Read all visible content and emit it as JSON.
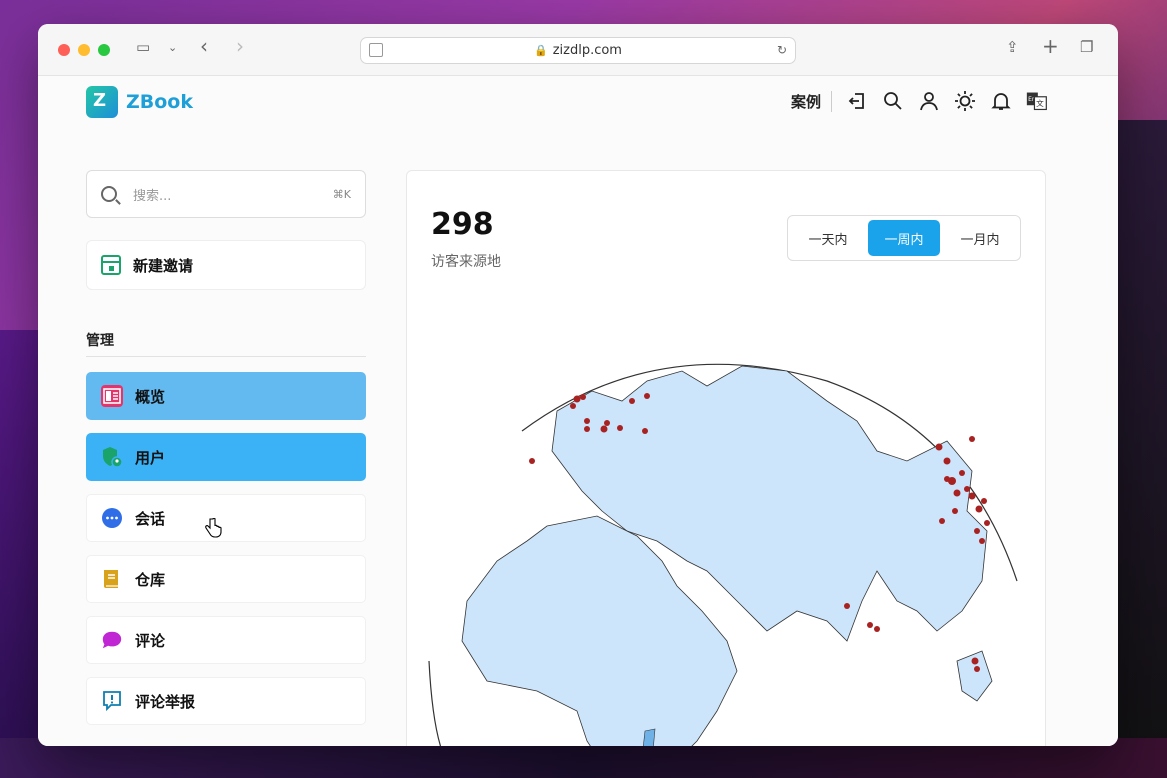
{
  "browser": {
    "url": "zizdlp.com"
  },
  "header": {
    "logo_text": "ZBook",
    "nav_case": "案例",
    "icons": [
      "logout-icon",
      "search-icon",
      "user-icon",
      "theme-sun-icon",
      "bell-icon",
      "language-icon"
    ]
  },
  "sidebar": {
    "search_placeholder": "搜索...",
    "search_shortcut": "⌘K",
    "new_invite": "新建邀请",
    "section_title": "管理",
    "items": [
      {
        "label": "概览",
        "icon": "overview-icon",
        "color": "#e8336a"
      },
      {
        "label": "用户",
        "icon": "shield-user-icon",
        "color": "#1aa36a"
      },
      {
        "label": "会话",
        "icon": "chat-dots-icon",
        "color": "#2f6ee6"
      },
      {
        "label": "仓库",
        "icon": "book-icon",
        "color": "#d9a21b"
      },
      {
        "label": "评论",
        "icon": "comment-icon",
        "color": "#c026d3"
      },
      {
        "label": "评论举报",
        "icon": "report-icon",
        "color": "#0e7fb0"
      }
    ]
  },
  "main": {
    "stat_value": "298",
    "stat_label": "访客来源地",
    "ranges": [
      "一天内",
      "一周内",
      "一月内"
    ],
    "selected_range": "一周内"
  },
  "colors": {
    "accent": "#1aa3ea",
    "land": "#cde5fb",
    "visitor_dot": "#a82222"
  }
}
